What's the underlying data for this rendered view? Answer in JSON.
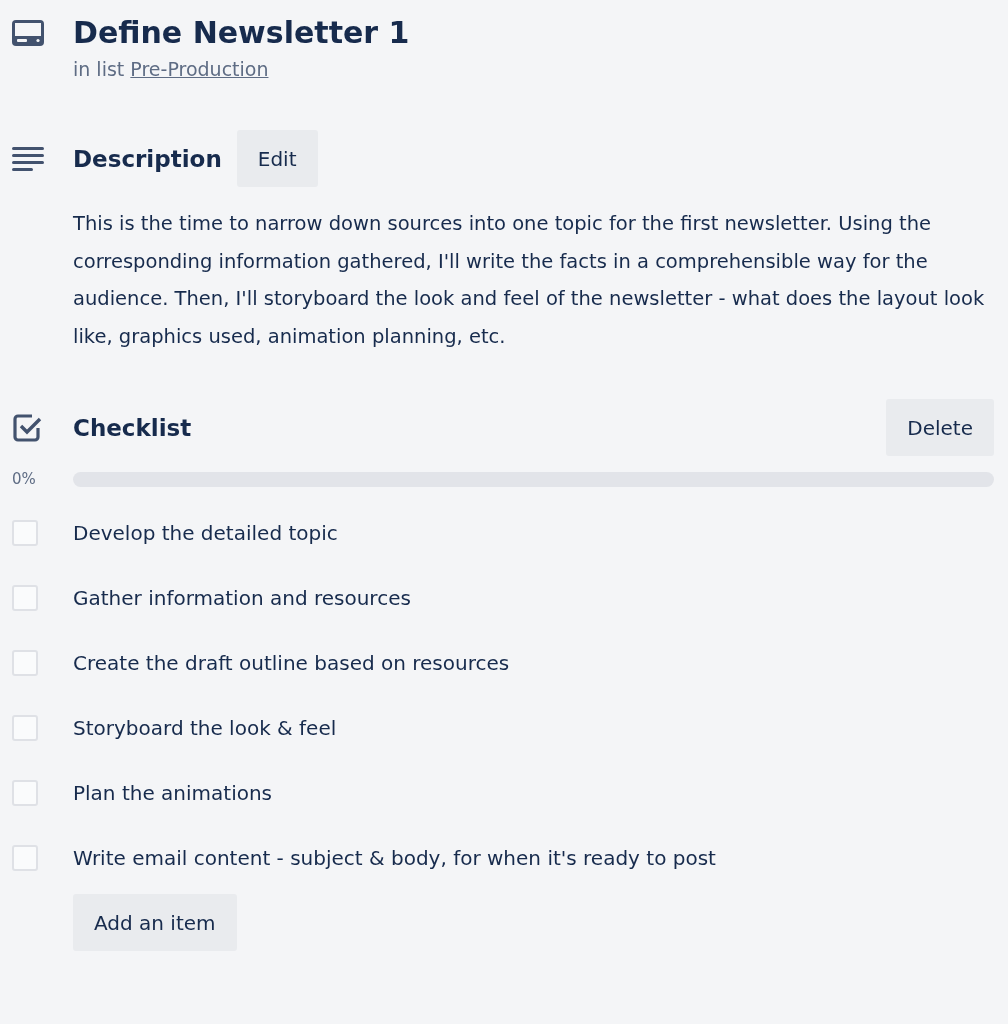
{
  "card": {
    "title": "Define Newsletter 1",
    "list_prefix": "in list",
    "list_name": "Pre-Production"
  },
  "description": {
    "heading": "Description",
    "edit_button": "Edit",
    "text": "This is the time to narrow down sources into one topic for the first newsletter. Using the corresponding information gathered, I'll write the facts in a comprehensible way for the audience. Then, I'll storyboard the look and feel of the newsletter - what does the layout look like, graphics used, animation planning, etc."
  },
  "checklist": {
    "heading": "Checklist",
    "delete_button": "Delete",
    "percent": "0%",
    "level": 0,
    "items": [
      {
        "label": "Develop the detailed topic",
        "checked": false
      },
      {
        "label": "Gather information and resources",
        "checked": false
      },
      {
        "label": "Create the draft outline based on resources",
        "checked": false
      },
      {
        "label": "Storyboard the look & feel",
        "checked": false
      },
      {
        "label": "Plan the animations",
        "checked": false
      },
      {
        "label": "Write email content - subject & body, for when it's ready to post",
        "checked": false
      }
    ],
    "add_button": "Add an item"
  }
}
